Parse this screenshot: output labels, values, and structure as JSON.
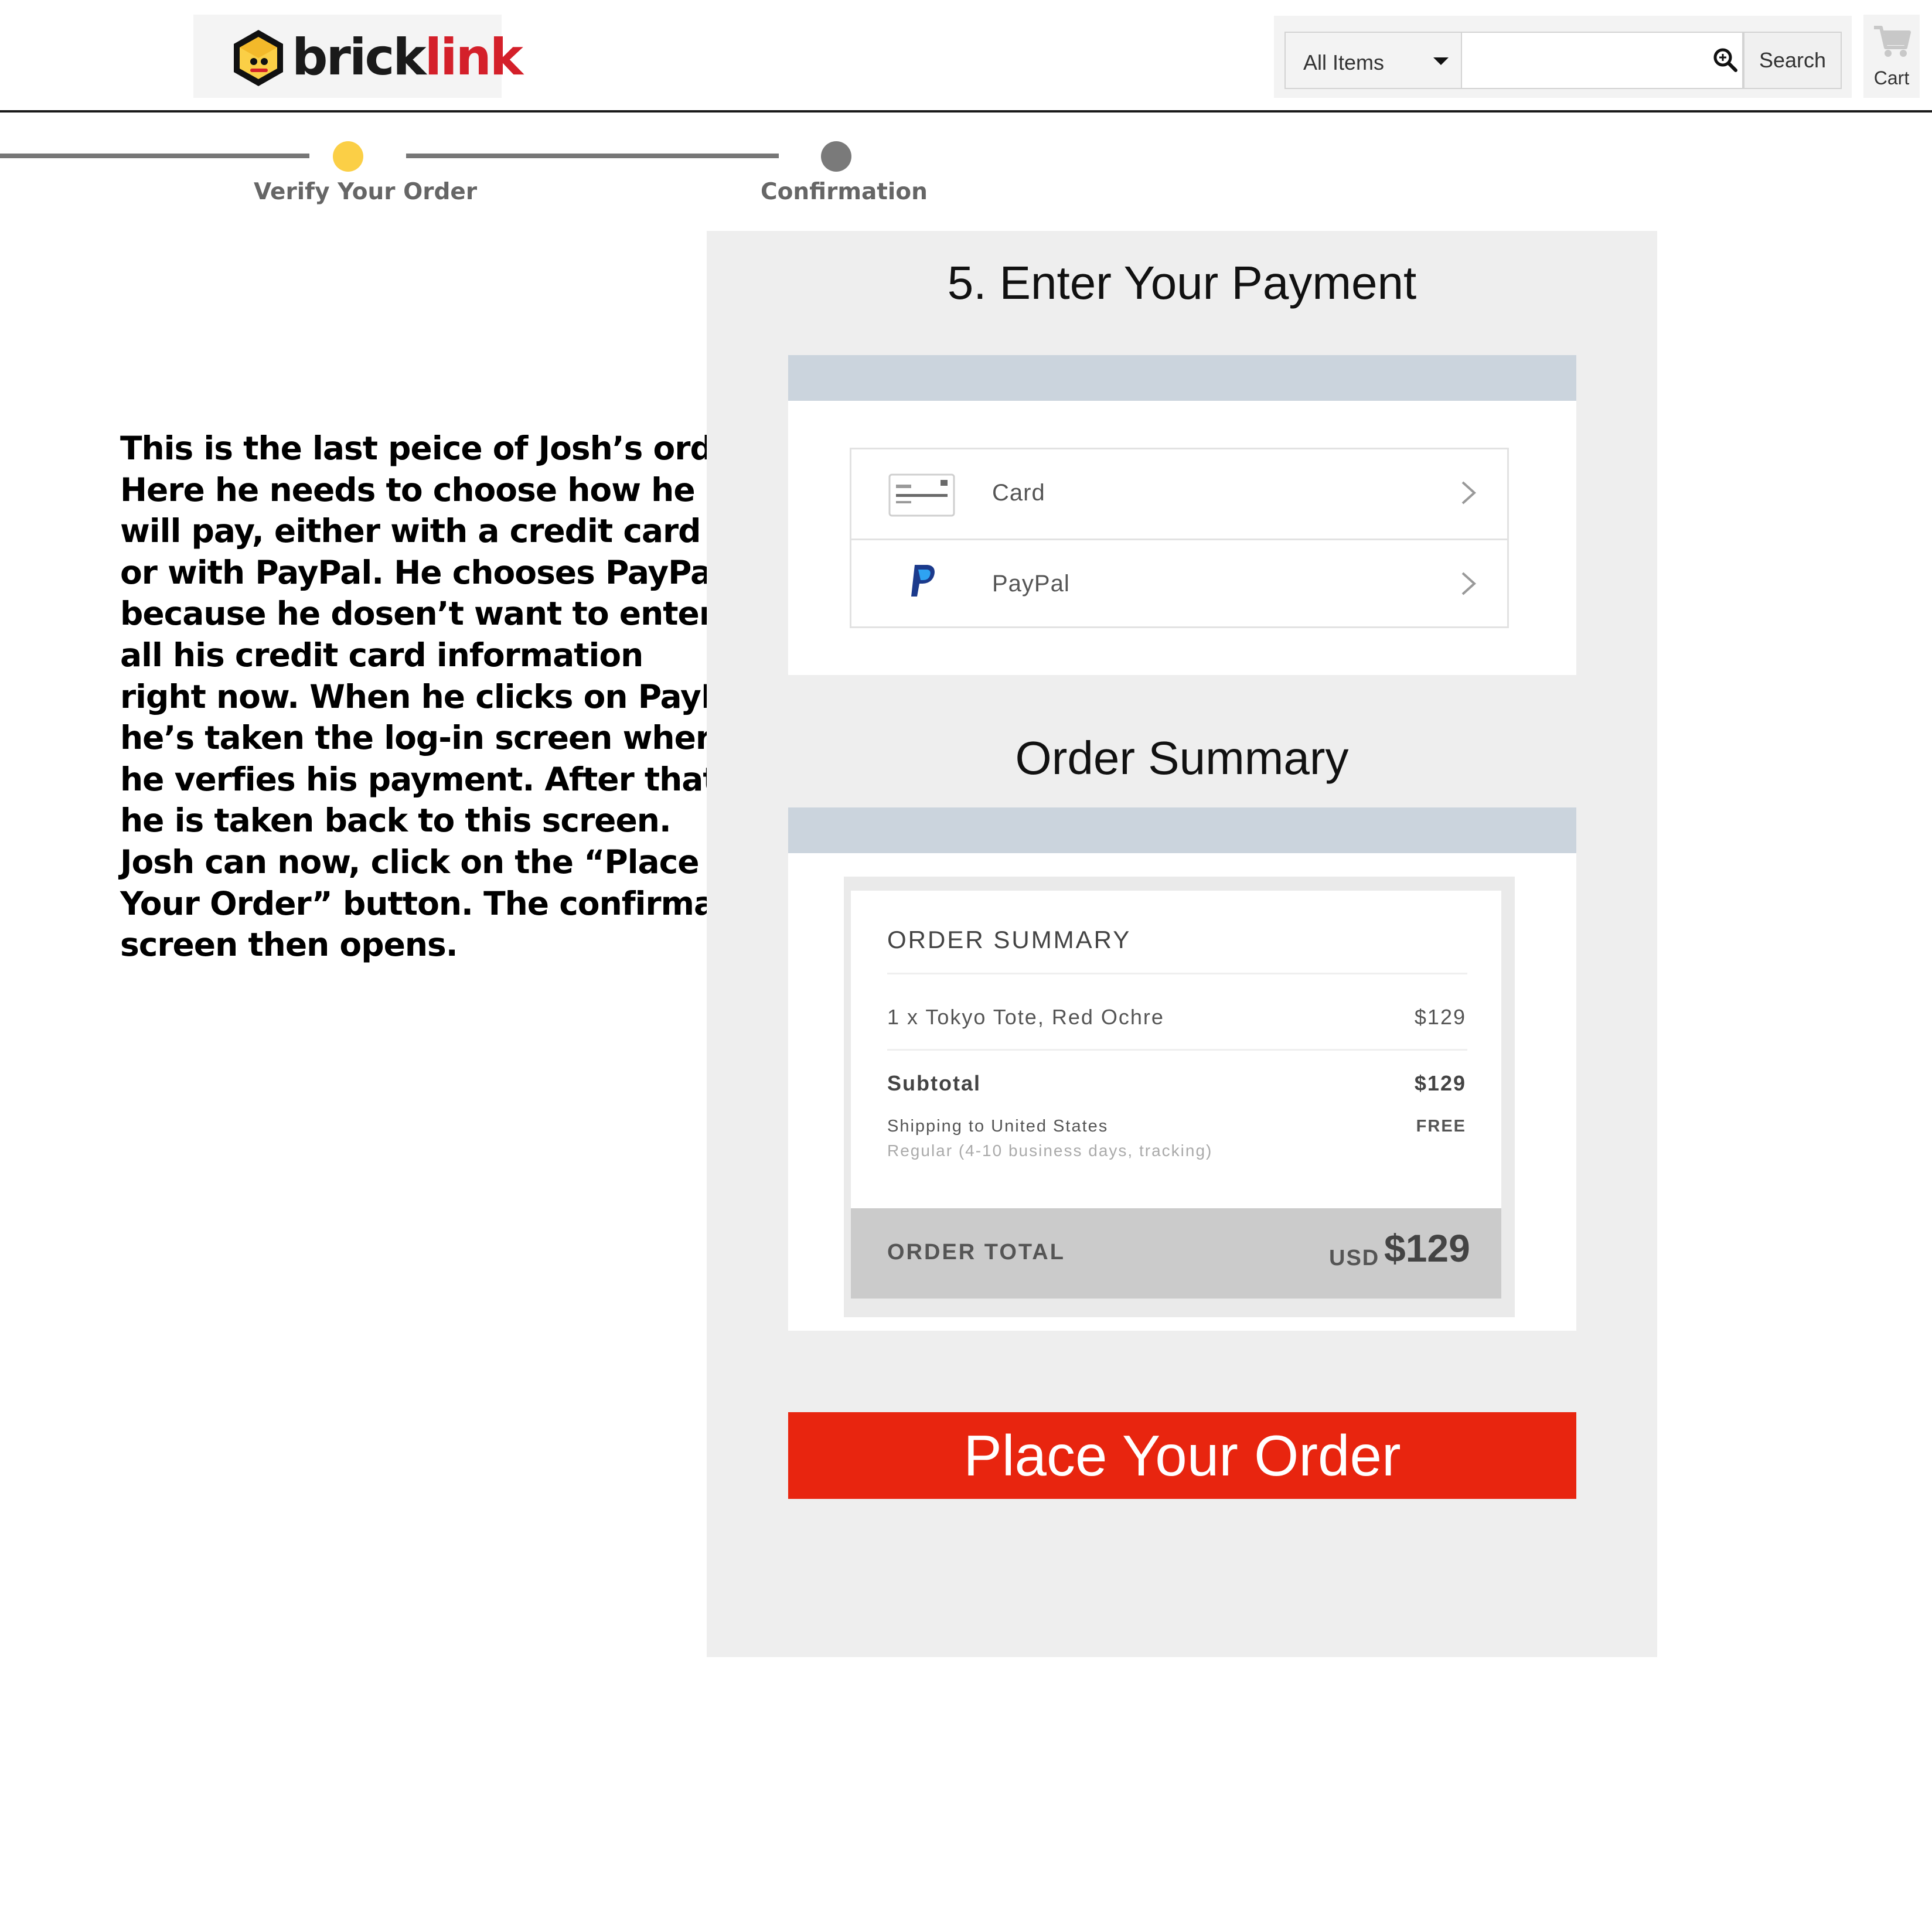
{
  "header": {
    "logo_text_dark": "brick",
    "logo_text_red": "link",
    "search": {
      "category_selected": "All Items",
      "placeholder": "",
      "button_label": "Search"
    },
    "cart_label": "Cart"
  },
  "progress": {
    "steps": [
      {
        "label": "Verify Your Order",
        "state": "current",
        "color": "#fbcf46"
      },
      {
        "label": "Confirmation",
        "state": "upcoming",
        "color": "#7a7a7a"
      }
    ]
  },
  "description": {
    "lines": [
      "This is the last peice of Josh’s order.",
      "Here he needs to choose how he",
      "will pay, either with a credit card",
      "or with PayPal. He chooses PayPal",
      "because he dosen’t want to enter",
      "all his credit card information",
      "right now. When he clicks on PayPal",
      "he’s taken the log-in screen where",
      "he verfies his payment. After that",
      "he is taken back to this screen.",
      "Josh can now, click on the “Place",
      "Your Order” button. The confirmaton",
      "screen then opens."
    ]
  },
  "payment": {
    "heading": "5. Enter Your Payment",
    "options": [
      {
        "label": "Card",
        "icon": "credit-card-icon"
      },
      {
        "label": "PayPal",
        "icon": "paypal-icon"
      }
    ]
  },
  "summary": {
    "heading": "Order Summary",
    "title": "ORDER SUMMARY",
    "item_line": "1 x Tokyo Tote, Red Ochre",
    "item_price": "$129",
    "subtotal_label": "Subtotal",
    "subtotal_value": "$129",
    "shipping_label": "Shipping to United States",
    "shipping_value": "FREE",
    "shipping_detail": "Regular (4-10 business days, tracking)",
    "total_label": "ORDER TOTAL",
    "total_currency": "USD",
    "total_amount": "$129"
  },
  "place_order_label": "Place Your Order",
  "colors": {
    "brand_red": "#d4202a",
    "place_order_red": "#e8250f",
    "step_active": "#fbcf46",
    "step_inactive": "#7a7a7a",
    "section_bar": "#cbd4dd",
    "paypal_blue": "#1b3a8c"
  }
}
